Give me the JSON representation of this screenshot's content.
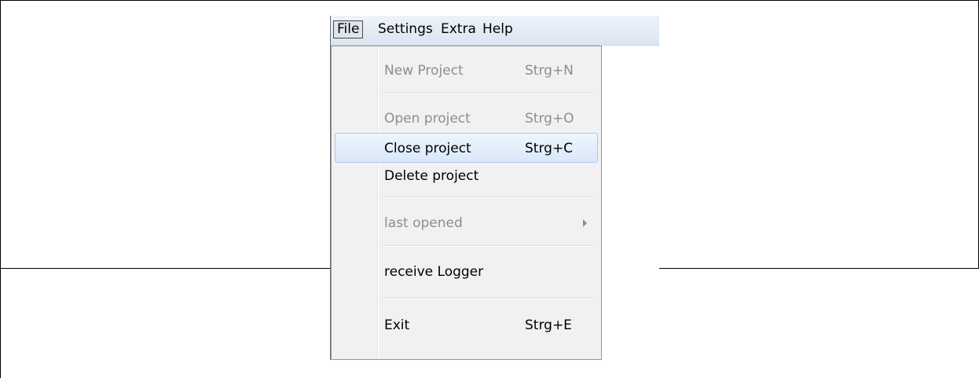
{
  "menubar": {
    "items": [
      "File",
      "Settings",
      "Extra",
      "Help"
    ]
  },
  "file_menu": {
    "items": [
      {
        "label": "New Project",
        "shortcut": "Strg+N",
        "enabled": false
      },
      {
        "label": "Open project",
        "shortcut": "Strg+O",
        "enabled": false
      },
      {
        "label": "Close project",
        "shortcut": "Strg+C",
        "enabled": true,
        "highlighted": true
      },
      {
        "label": "Delete project",
        "shortcut": "",
        "enabled": true
      },
      {
        "label": "last opened",
        "shortcut": "",
        "enabled": false,
        "submenu_icon": "chevron-right-icon"
      },
      {
        "label": "receive Logger",
        "shortcut": "",
        "enabled": true
      },
      {
        "label": "Exit",
        "shortcut": "Strg+E",
        "enabled": true
      }
    ]
  },
  "colors": {
    "highlight_border": "#a8c8ea",
    "disabled_text": "#8d8d8d",
    "menu_background": "#f1f1f1"
  }
}
